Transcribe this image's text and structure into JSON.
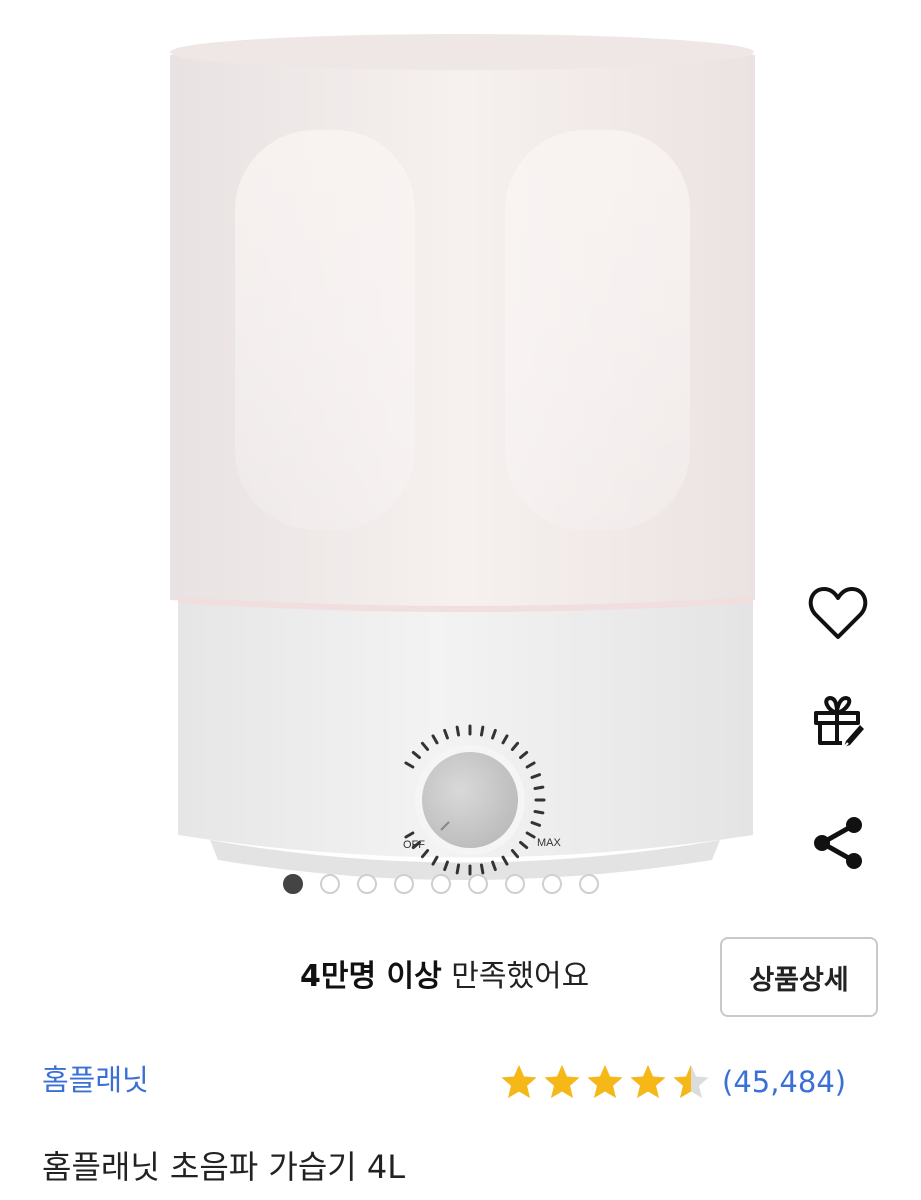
{
  "product_image": {
    "description_icon": "humidifier-product-photo",
    "dial_labels": {
      "off": "OFF",
      "max": "MAX"
    }
  },
  "gallery": {
    "count": 9,
    "active_index": 0
  },
  "side_actions": [
    {
      "name": "heart-icon"
    },
    {
      "name": "gift-icon"
    },
    {
      "name": "share-icon"
    }
  ],
  "satisfaction": {
    "bold": "4만명 이상",
    "rest": " 만족했어요"
  },
  "detail_button": {
    "label": "상품상세"
  },
  "brand": {
    "name": "홈플래닛"
  },
  "rating": {
    "value": 4.5,
    "max": 5,
    "review_count": "(45,484)",
    "star_color": "#f6b817"
  },
  "product": {
    "title": "홈플래닛 초음파 가습기 4L"
  }
}
